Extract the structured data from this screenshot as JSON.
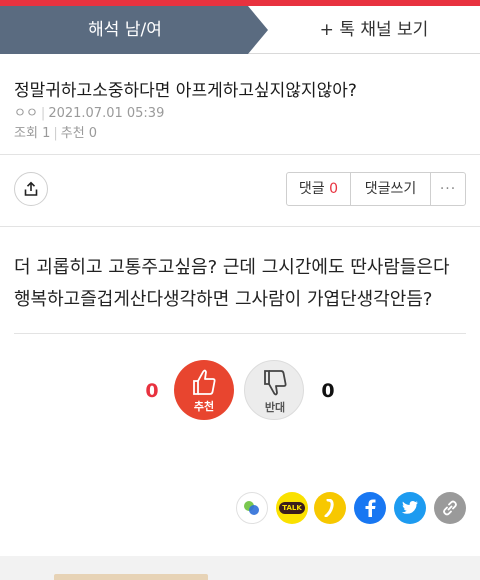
{
  "tabs": {
    "active_label": "해석 남/여",
    "other_label": "+ 톡 채널 보기",
    "active_color": "#5a6b80"
  },
  "post": {
    "title": "정말귀하고소중하다면 아프게하고싶지않지않아?",
    "author": "ㅇㅇ",
    "date": "2021.07.01 05:39",
    "views_label": "조회",
    "views": "1",
    "recommend_label": "추천",
    "recommend": "0",
    "body": "더 괴롭히고 고통주고싶음? 근데 그시간에도 딴사람들은다 행복하고즐겁게산다생각하면 그사람이 가엽단생각안듬?"
  },
  "actions": {
    "share_icon": "share-icon",
    "comments_label": "댓글",
    "comments_count": "0",
    "write_comment_label": "댓글쓰기",
    "more_label": "···"
  },
  "votes": {
    "up_count": "0",
    "up_label": "추천",
    "down_count": "0",
    "down_label": "반대",
    "up_color": "#e8452f"
  },
  "social": {
    "kakao_talk_label": "TALK",
    "icons": [
      "band-icon",
      "kakaotalk-icon",
      "kakaostory-icon",
      "facebook-icon",
      "twitter-icon",
      "link-icon"
    ]
  },
  "colors": {
    "accent": "#e8323f",
    "facebook": "#1877f2",
    "twitter": "#1d9bf0",
    "kakao": "#fae100"
  }
}
